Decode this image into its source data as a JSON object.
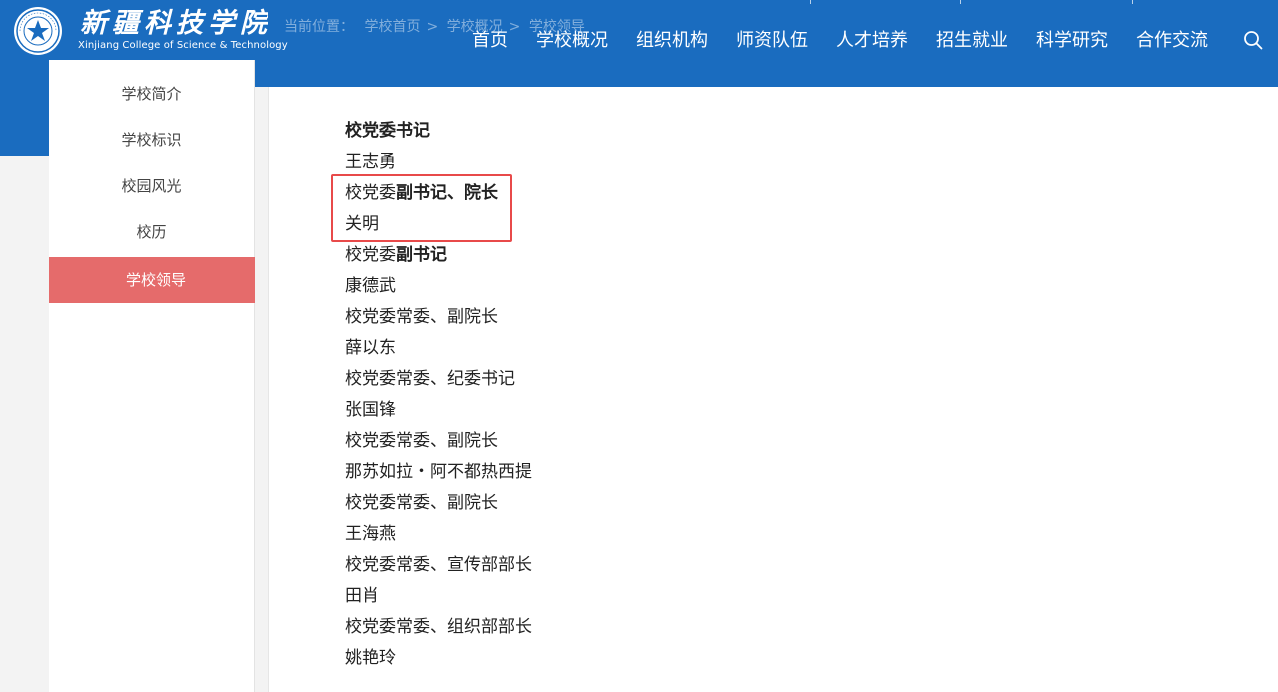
{
  "header": {
    "logo_title": "新疆科技学院",
    "logo_subtitle": "Xinjiang College of Science & Technology",
    "brand_color": "#1a6cbf",
    "search_icon": "search-icon"
  },
  "breadcrumb": {
    "prefix": "当前位置：",
    "items": [
      "学校首页",
      "学校概况",
      "学校领导"
    ],
    "separator": ">"
  },
  "nav": {
    "items": [
      "首页",
      "学校概况",
      "组织机构",
      "师资队伍",
      "人才培养",
      "招生就业",
      "科学研究",
      "合作交流"
    ]
  },
  "sidebar": {
    "items": [
      {
        "label": "学校简介",
        "active": false
      },
      {
        "label": "学校标识",
        "active": false
      },
      {
        "label": "校园风光",
        "active": false
      },
      {
        "label": "校历",
        "active": false
      },
      {
        "label": "学校领导",
        "active": true
      }
    ],
    "active_color": "#e56b6b"
  },
  "leaders": [
    {
      "title_plain": "",
      "title_bold": "校党委书记",
      "name": "王志勇"
    },
    {
      "title_plain": "校党委",
      "title_bold": "副书记、院长",
      "name": "关明"
    },
    {
      "title_plain": "校党委",
      "title_bold": "副书记",
      "name": "康德武"
    },
    {
      "title_plain": "校党委常委、副院长",
      "title_bold": "",
      "name": "薛以东"
    },
    {
      "title_plain": "校党委常委、纪委书记",
      "title_bold": "",
      "name": "张国锋"
    },
    {
      "title_plain": "校党委常委、副院长",
      "title_bold": "",
      "name": "那苏如拉・阿不都热西提"
    },
    {
      "title_plain": "校党委常委、副院长",
      "title_bold": "",
      "name": "王海燕"
    },
    {
      "title_plain": "校党委常委、宣传部部长",
      "title_bold": "",
      "name": "田肖"
    },
    {
      "title_plain": "校党委常委、组织部部长",
      "title_bold": "",
      "name": "姚艳玲"
    }
  ],
  "highlight_color": "#e84a4a"
}
